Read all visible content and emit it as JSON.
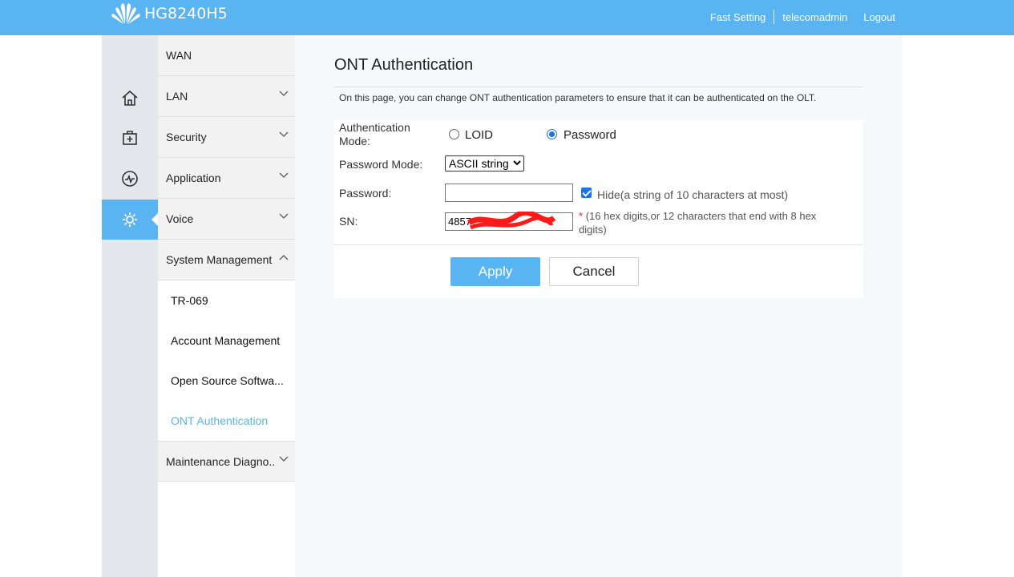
{
  "header": {
    "model": "HG8240H5",
    "links": [
      "Fast Setting",
      "telecomadmin",
      "Logout"
    ],
    "accent_color": "#5ab4f2"
  },
  "rail": {
    "icons": [
      "home-icon",
      "first-aid-icon",
      "pulse-icon",
      "gear-icon"
    ],
    "active": "gear-icon"
  },
  "menu": {
    "wan": "WAN",
    "lan": "LAN",
    "security": "Security",
    "application": "Application",
    "voice": "Voice",
    "system_management": "System Management",
    "sub_items": [
      "TR-069",
      "Account Management",
      "Open Source Softwa...",
      "ONT Authentication"
    ],
    "active_sub_item": "ONT Authentication",
    "maintenance": "Maintenance Diagno.."
  },
  "page": {
    "title": "ONT Authentication",
    "description": "On this page, you can change ONT authentication parameters to ensure that it can be authenticated on the OLT."
  },
  "form": {
    "auth_mode_label_1": "Authentication",
    "auth_mode_label_2": "Mode:",
    "auth_options": [
      "LOID",
      "Password"
    ],
    "auth_selected": "Password",
    "password_mode_label": "Password Mode:",
    "password_mode_value": "ASCII string",
    "password_label": "Password:",
    "password_value": "",
    "hide_checked": true,
    "hide_label": "Hide(a string of 10 characters at most)",
    "sn_label": "SN:",
    "sn_value": "4857",
    "sn_required_mark": "*",
    "sn_note_1": "(16 hex digits,or 12 characters that end with 8 hex",
    "sn_note_2": "digits)"
  },
  "buttons": {
    "apply": "Apply",
    "cancel": "Cancel"
  }
}
